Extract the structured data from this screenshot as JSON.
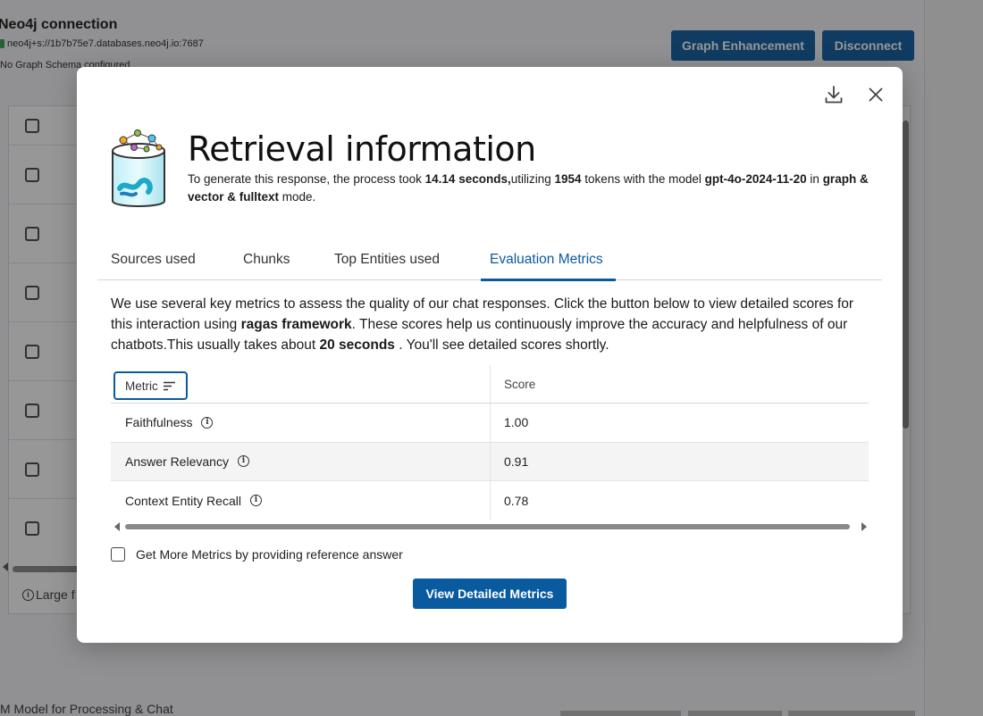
{
  "background": {
    "connection_title": "Neo4j connection",
    "connection_url": "neo4j+s://1b7b75e7.databases.neo4j.io:7687",
    "schema_status": "No Graph Schema configured",
    "graph_enhancement_label": "Graph Enhancement",
    "disconnect_label": "Disconnect",
    "large_files_text": "Large f",
    "model_label": "M Model for Processing & Chat",
    "colors": {
      "primary": "#0a5aa0",
      "status_green": "#2e9e4a"
    }
  },
  "modal": {
    "title": "Retrieval information",
    "icon": "database-graph-icon",
    "desc": {
      "part1": "To generate this response, the process took ",
      "seconds": "14.14 seconds,",
      "part2": "utilizing ",
      "tokens": "1954",
      "part3": " tokens with the model ",
      "model": "gpt-4o-2024-11-20",
      "part4": " in ",
      "mode": "graph & vector & fulltext",
      "part5": " mode."
    },
    "tabs": [
      {
        "label": "Sources used"
      },
      {
        "label": "Chunks"
      },
      {
        "label": "Top Entities used"
      },
      {
        "label": "Evaluation Metrics"
      }
    ],
    "intro": {
      "part1": "We use several key metrics to assess the quality of our chat responses. Click the button below to view detailed scores for this interaction using ",
      "framework": "ragas framework",
      "part2": ". These scores help us continuously improve the accuracy and helpfulness of our chatbots.This usually takes about ",
      "duration": "20 seconds",
      "part3": " . You'll see detailed scores shortly."
    },
    "table": {
      "metric_header": "Metric",
      "score_header": "Score",
      "rows": [
        {
          "metric": "Faithfulness",
          "score": "1.00"
        },
        {
          "metric": "Answer Relevancy",
          "score": "0.91"
        },
        {
          "metric": "Context Entity Recall",
          "score": "0.78"
        }
      ]
    },
    "more_metrics_label": "Get More Metrics by providing reference answer",
    "view_button_label": "View Detailed Metrics"
  }
}
